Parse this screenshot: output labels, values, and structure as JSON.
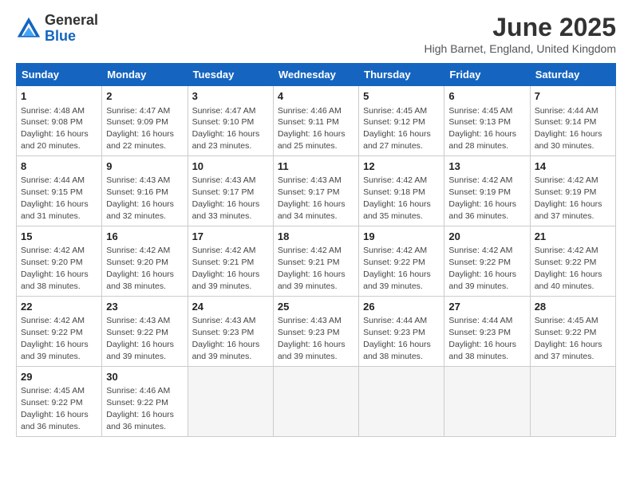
{
  "logo": {
    "general": "General",
    "blue": "Blue"
  },
  "header": {
    "month": "June 2025",
    "location": "High Barnet, England, United Kingdom"
  },
  "weekdays": [
    "Sunday",
    "Monday",
    "Tuesday",
    "Wednesday",
    "Thursday",
    "Friday",
    "Saturday"
  ],
  "weeks": [
    [
      {
        "day": "1",
        "info": "Sunrise: 4:48 AM\nSunset: 9:08 PM\nDaylight: 16 hours\nand 20 minutes."
      },
      {
        "day": "2",
        "info": "Sunrise: 4:47 AM\nSunset: 9:09 PM\nDaylight: 16 hours\nand 22 minutes."
      },
      {
        "day": "3",
        "info": "Sunrise: 4:47 AM\nSunset: 9:10 PM\nDaylight: 16 hours\nand 23 minutes."
      },
      {
        "day": "4",
        "info": "Sunrise: 4:46 AM\nSunset: 9:11 PM\nDaylight: 16 hours\nand 25 minutes."
      },
      {
        "day": "5",
        "info": "Sunrise: 4:45 AM\nSunset: 9:12 PM\nDaylight: 16 hours\nand 27 minutes."
      },
      {
        "day": "6",
        "info": "Sunrise: 4:45 AM\nSunset: 9:13 PM\nDaylight: 16 hours\nand 28 minutes."
      },
      {
        "day": "7",
        "info": "Sunrise: 4:44 AM\nSunset: 9:14 PM\nDaylight: 16 hours\nand 30 minutes."
      }
    ],
    [
      {
        "day": "8",
        "info": "Sunrise: 4:44 AM\nSunset: 9:15 PM\nDaylight: 16 hours\nand 31 minutes."
      },
      {
        "day": "9",
        "info": "Sunrise: 4:43 AM\nSunset: 9:16 PM\nDaylight: 16 hours\nand 32 minutes."
      },
      {
        "day": "10",
        "info": "Sunrise: 4:43 AM\nSunset: 9:17 PM\nDaylight: 16 hours\nand 33 minutes."
      },
      {
        "day": "11",
        "info": "Sunrise: 4:43 AM\nSunset: 9:17 PM\nDaylight: 16 hours\nand 34 minutes."
      },
      {
        "day": "12",
        "info": "Sunrise: 4:42 AM\nSunset: 9:18 PM\nDaylight: 16 hours\nand 35 minutes."
      },
      {
        "day": "13",
        "info": "Sunrise: 4:42 AM\nSunset: 9:19 PM\nDaylight: 16 hours\nand 36 minutes."
      },
      {
        "day": "14",
        "info": "Sunrise: 4:42 AM\nSunset: 9:19 PM\nDaylight: 16 hours\nand 37 minutes."
      }
    ],
    [
      {
        "day": "15",
        "info": "Sunrise: 4:42 AM\nSunset: 9:20 PM\nDaylight: 16 hours\nand 38 minutes."
      },
      {
        "day": "16",
        "info": "Sunrise: 4:42 AM\nSunset: 9:20 PM\nDaylight: 16 hours\nand 38 minutes."
      },
      {
        "day": "17",
        "info": "Sunrise: 4:42 AM\nSunset: 9:21 PM\nDaylight: 16 hours\nand 39 minutes."
      },
      {
        "day": "18",
        "info": "Sunrise: 4:42 AM\nSunset: 9:21 PM\nDaylight: 16 hours\nand 39 minutes."
      },
      {
        "day": "19",
        "info": "Sunrise: 4:42 AM\nSunset: 9:22 PM\nDaylight: 16 hours\nand 39 minutes."
      },
      {
        "day": "20",
        "info": "Sunrise: 4:42 AM\nSunset: 9:22 PM\nDaylight: 16 hours\nand 39 minutes."
      },
      {
        "day": "21",
        "info": "Sunrise: 4:42 AM\nSunset: 9:22 PM\nDaylight: 16 hours\nand 40 minutes."
      }
    ],
    [
      {
        "day": "22",
        "info": "Sunrise: 4:42 AM\nSunset: 9:22 PM\nDaylight: 16 hours\nand 39 minutes."
      },
      {
        "day": "23",
        "info": "Sunrise: 4:43 AM\nSunset: 9:22 PM\nDaylight: 16 hours\nand 39 minutes."
      },
      {
        "day": "24",
        "info": "Sunrise: 4:43 AM\nSunset: 9:23 PM\nDaylight: 16 hours\nand 39 minutes."
      },
      {
        "day": "25",
        "info": "Sunrise: 4:43 AM\nSunset: 9:23 PM\nDaylight: 16 hours\nand 39 minutes."
      },
      {
        "day": "26",
        "info": "Sunrise: 4:44 AM\nSunset: 9:23 PM\nDaylight: 16 hours\nand 38 minutes."
      },
      {
        "day": "27",
        "info": "Sunrise: 4:44 AM\nSunset: 9:23 PM\nDaylight: 16 hours\nand 38 minutes."
      },
      {
        "day": "28",
        "info": "Sunrise: 4:45 AM\nSunset: 9:22 PM\nDaylight: 16 hours\nand 37 minutes."
      }
    ],
    [
      {
        "day": "29",
        "info": "Sunrise: 4:45 AM\nSunset: 9:22 PM\nDaylight: 16 hours\nand 36 minutes."
      },
      {
        "day": "30",
        "info": "Sunrise: 4:46 AM\nSunset: 9:22 PM\nDaylight: 16 hours\nand 36 minutes."
      },
      {
        "day": "",
        "info": ""
      },
      {
        "day": "",
        "info": ""
      },
      {
        "day": "",
        "info": ""
      },
      {
        "day": "",
        "info": ""
      },
      {
        "day": "",
        "info": ""
      }
    ]
  ]
}
